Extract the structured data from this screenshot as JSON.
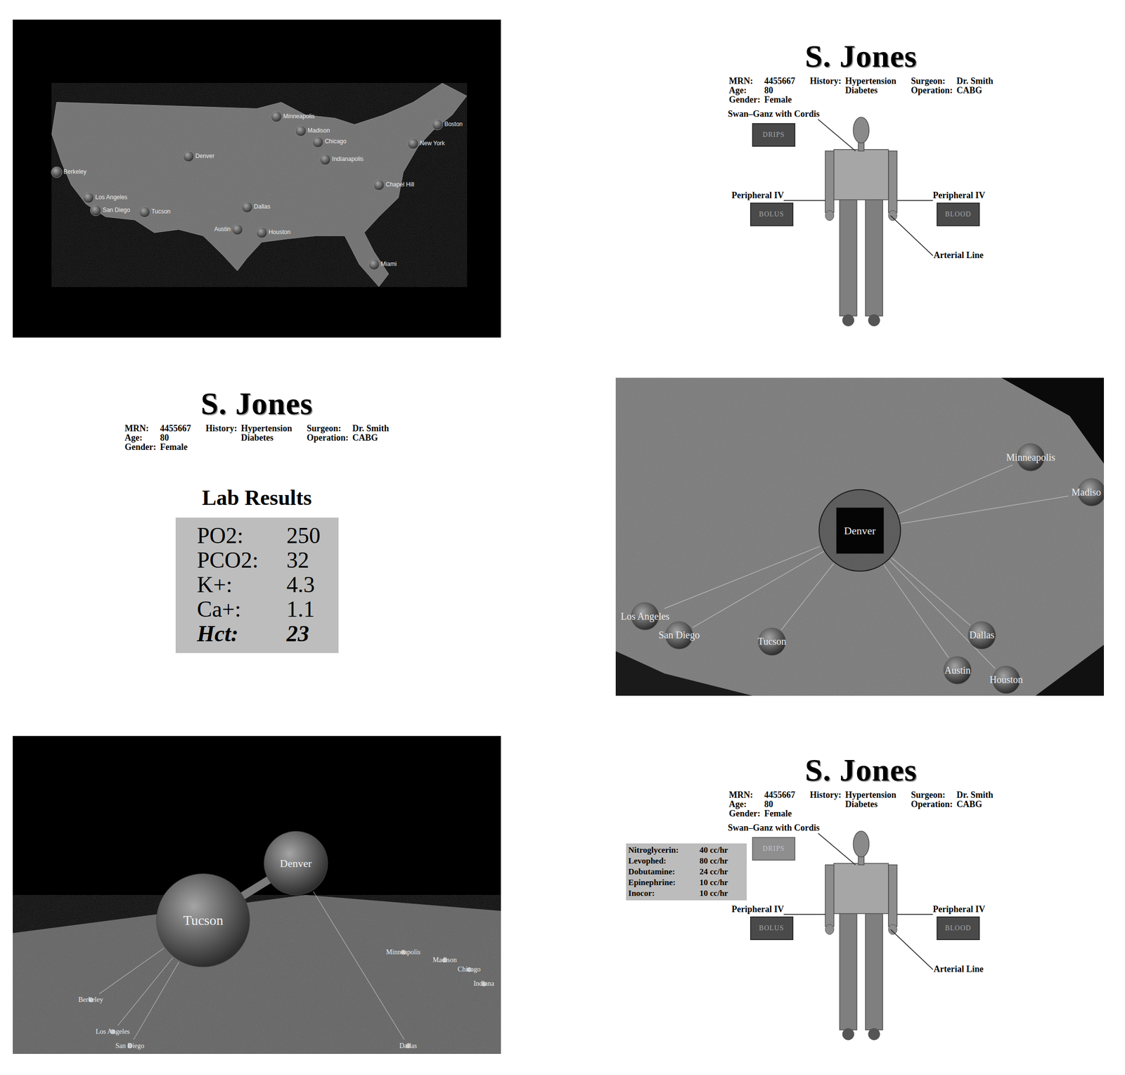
{
  "map_overview": {
    "cities": [
      "Berkeley",
      "Los Angeles",
      "San Diego",
      "Tucson",
      "Denver",
      "Minneapolis",
      "Madison",
      "Chicago",
      "Indianapolis",
      "New York",
      "Boston",
      "Chapel Hill",
      "Dallas",
      "Austin",
      "Houston",
      "Miami"
    ]
  },
  "patient": {
    "name": "S. Jones",
    "header": [
      {
        "rows": [
          {
            "label": "MRN:",
            "values": [
              "4455667"
            ]
          },
          {
            "label": "Age:",
            "values": [
              "80"
            ]
          },
          {
            "label": "Gender:",
            "values": [
              "Female"
            ]
          }
        ]
      },
      {
        "rows": [
          {
            "label": "History:",
            "values": [
              "Hypertension",
              "Diabetes"
            ]
          }
        ]
      },
      {
        "rows": [
          {
            "label": "Surgeon:",
            "values": [
              "Dr. Smith"
            ]
          },
          {
            "label": "Operation:",
            "values": [
              "CABG"
            ]
          }
        ]
      }
    ]
  },
  "patient_lines_view": {
    "lines": [
      {
        "label": "Swan–Ganz with Cordis"
      },
      {
        "label": "Peripheral IV"
      },
      {
        "label": "Peripheral IV"
      },
      {
        "label": "Arterial Line"
      }
    ],
    "buttons": [
      {
        "label": "DRIPS",
        "selected": false
      },
      {
        "label": "BOLUS",
        "selected": false
      },
      {
        "label": "BLOOD",
        "selected": false
      }
    ]
  },
  "lab_results": {
    "title": "Lab Results",
    "results": [
      {
        "name": "PO2:",
        "value": "250",
        "flagged": false
      },
      {
        "name": "PCO2:",
        "value": "32",
        "flagged": false
      },
      {
        "name": "K+:",
        "value": "4.3",
        "flagged": false
      },
      {
        "name": "Ca+:",
        "value": "1.1",
        "flagged": false
      },
      {
        "name": "Hct:",
        "value": "23",
        "flagged": true
      }
    ]
  },
  "map_zoom": {
    "focus": "Denver",
    "cities": [
      "Minneapolis",
      "Madiso",
      "Los Angeles",
      "San Diego",
      "Tucson",
      "Dallas",
      "Austin",
      "Houston"
    ]
  },
  "map_3d": {
    "cities": [
      {
        "name": "Tucson",
        "selected": true
      },
      {
        "name": "Denver",
        "selected": true
      },
      {
        "name": "Minneapolis",
        "selected": false
      },
      {
        "name": "Madison",
        "selected": false
      },
      {
        "name": "Chicago",
        "selected": false
      },
      {
        "name": "Indiana",
        "selected": false
      },
      {
        "name": "Berkeley",
        "selected": false
      },
      {
        "name": "Los Angeles",
        "selected": false
      },
      {
        "name": "San Diego",
        "selected": false
      },
      {
        "name": "Dallas",
        "selected": false
      }
    ]
  },
  "patient_drips_view": {
    "lines": [
      {
        "label": "Swan–Ganz with Cordis"
      },
      {
        "label": "Peripheral IV"
      },
      {
        "label": "Peripheral IV"
      },
      {
        "label": "Arterial Line"
      }
    ],
    "buttons": [
      {
        "label": "DRIPS",
        "selected": true
      },
      {
        "label": "BOLUS",
        "selected": false
      },
      {
        "label": "BLOOD",
        "selected": false
      }
    ],
    "drips": [
      {
        "name": "Nitroglycerin:",
        "rate": "40 cc/hr"
      },
      {
        "name": "Levophed:",
        "rate": "80 cc/hr"
      },
      {
        "name": "Dobutamine:",
        "rate": "24 cc/hr"
      },
      {
        "name": "Epinephrine:",
        "rate": "10 cc/hr"
      },
      {
        "name": "Inocor:",
        "rate": "10 cc/hr"
      }
    ]
  }
}
